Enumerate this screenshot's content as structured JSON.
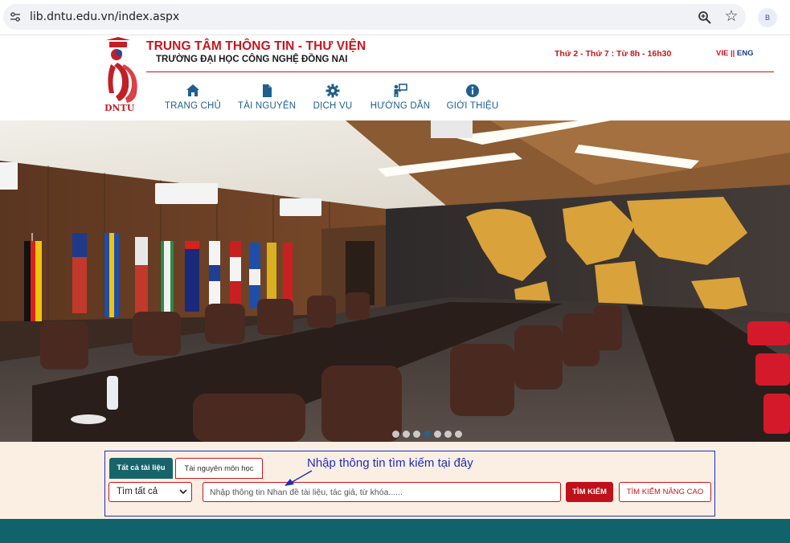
{
  "browser": {
    "url": "lib.dntu.edu.vn/index.aspx",
    "profile_initial": "B",
    "icons": {
      "site_info": "tune-icon",
      "zoom": "zoom-icon",
      "bookmark": "star-icon"
    }
  },
  "header": {
    "logo_text": "DNTU",
    "title": "TRUNG TÂM THÔNG TIN - THƯ VIỆN",
    "subtitle": "TRƯỜNG ĐẠI HỌC CÔNG NGHỆ ĐỒNG NAI",
    "opening_hours": "Thứ 2 - Thứ 7 : Từ 8h - 16h30",
    "lang_vie": "VIE",
    "lang_sep": " || ",
    "lang_eng": "ENG",
    "accent_color": "#c8151d"
  },
  "nav": {
    "items": [
      {
        "label": "TRANG CHỦ",
        "icon": "home-icon"
      },
      {
        "label": "TÀI NGUYÊN",
        "icon": "file-icon"
      },
      {
        "label": "DỊCH VỤ",
        "icon": "gear-icon"
      },
      {
        "label": "HƯỚNG DẪN",
        "icon": "guide-icon"
      },
      {
        "label": "GIỚI THIỆU",
        "icon": "info-icon"
      }
    ],
    "color": "#1f5f8f"
  },
  "carousel": {
    "slide_count": 7,
    "active_index": 4
  },
  "search": {
    "tabs": [
      {
        "label": "Tất cả tài liệu",
        "active": true
      },
      {
        "label": "Tài nguyên môn học",
        "active": false
      }
    ],
    "scope_selected": "Tìm tất cả",
    "input_placeholder": "Nhập thông tin Nhan đề tài liệu, tác giả, từ khóa......",
    "input_value": "",
    "search_button": "TÌM KIẾM",
    "advanced_button": "TÌM KIẾM NÂNG CAO",
    "annotation": "Nhập thông tin tìm kiếm tại đây",
    "annotation_color": "#1d2fbf"
  },
  "footer": {
    "color": "#10636b"
  }
}
